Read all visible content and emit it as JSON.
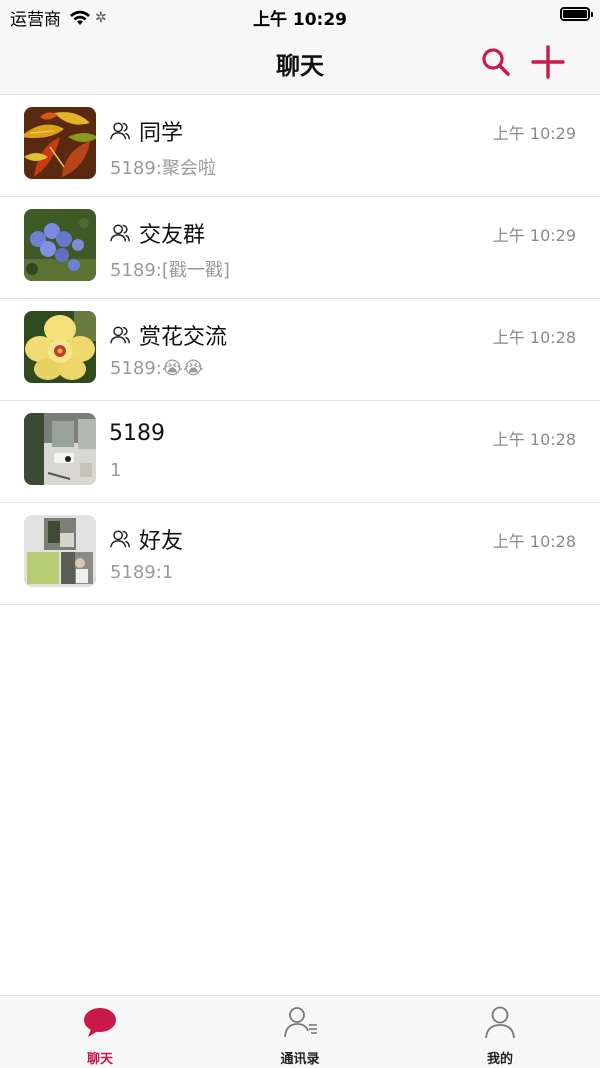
{
  "status_bar": {
    "carrier": "运营商",
    "time": "上午 10:29"
  },
  "nav": {
    "title": "聊天",
    "search_icon": "search-icon",
    "add_icon": "plus-icon",
    "accent_color": "#c8194a"
  },
  "chats": [
    {
      "name": "同学",
      "is_group": true,
      "time": "上午 10:29",
      "preview": "5189:聚会啦",
      "avatar": "croton-leaves-photo"
    },
    {
      "name": "交友群",
      "is_group": true,
      "time": "上午 10:29",
      "preview": "5189:[戳一戳]",
      "avatar": "blue-flowers-photo"
    },
    {
      "name": "赏花交流",
      "is_group": true,
      "time": "上午 10:28",
      "preview": "5189:😭😭",
      "avatar": "yellow-hibiscus-photo"
    },
    {
      "name": "5189",
      "is_group": false,
      "time": "上午 10:28",
      "preview": "1",
      "avatar": "desk-photo"
    },
    {
      "name": "好友",
      "is_group": true,
      "time": "上午 10:28",
      "preview": "5189:1",
      "avatar": "group-collage"
    }
  ],
  "tabs": [
    {
      "label": "聊天",
      "icon": "chat-bubble-icon",
      "active": true
    },
    {
      "label": "通讯录",
      "icon": "contacts-icon",
      "active": false
    },
    {
      "label": "我的",
      "icon": "person-icon",
      "active": false
    }
  ]
}
